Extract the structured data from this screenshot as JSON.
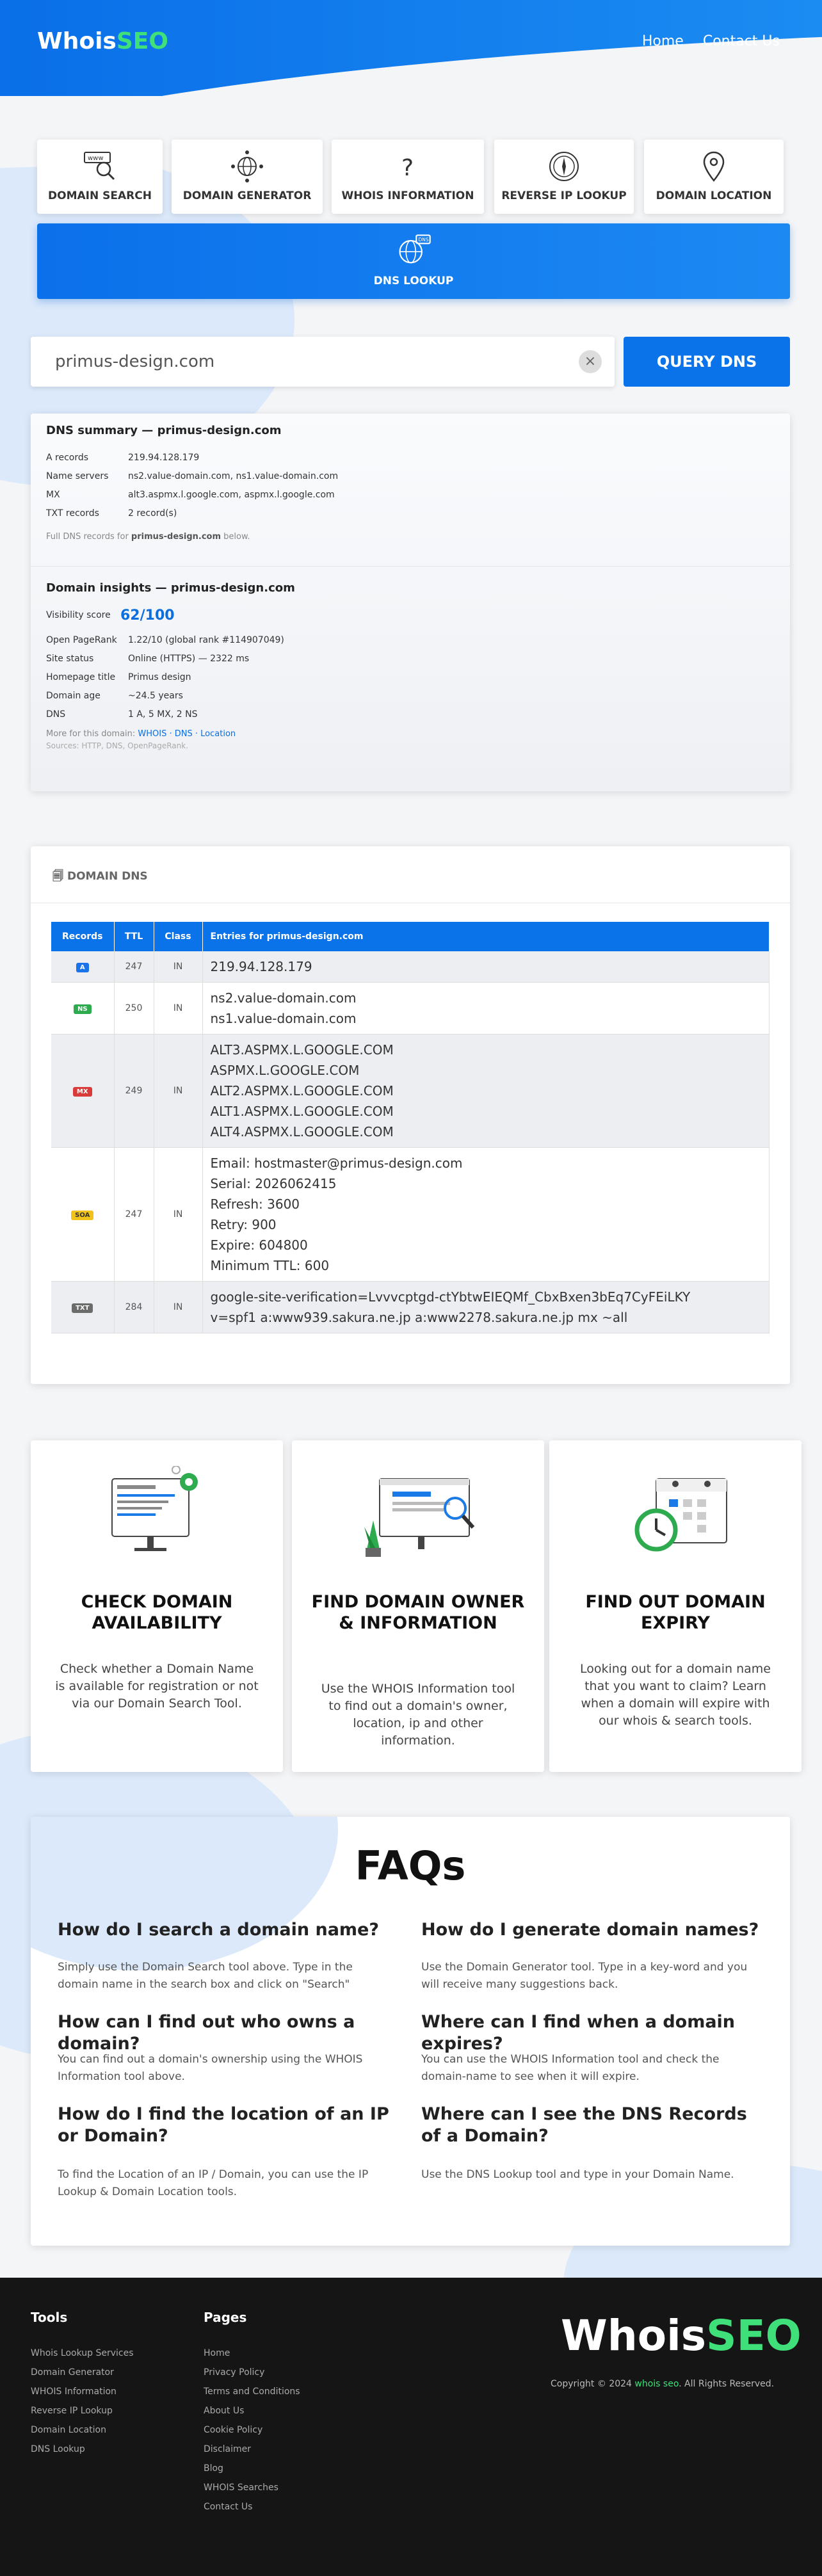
{
  "header": {
    "logo_main": "Whois",
    "logo_accent": "SEO",
    "nav": [
      "Home",
      "Contact Us"
    ]
  },
  "tools": [
    {
      "label": "DOMAIN SEARCH",
      "icon": "www-search-icon"
    },
    {
      "label": "DOMAIN GENERATOR",
      "icon": "network-globe-icon"
    },
    {
      "label": "WHOIS INFORMATION",
      "icon": "question-mark-icon"
    },
    {
      "label": "REVERSE IP LOOKUP",
      "icon": "compass-icon"
    },
    {
      "label": "DOMAIN LOCATION",
      "icon": "map-pin-icon"
    }
  ],
  "dns_lookup": {
    "label": "DNS LOOKUP",
    "icon": "dns-globe-icon"
  },
  "search": {
    "value": "primus-design.com",
    "clear": "×",
    "button": "QUERY DNS"
  },
  "summary": {
    "title": "DNS summary — primus-design.com",
    "rows": [
      {
        "k": "A records",
        "v": "219.94.128.179"
      },
      {
        "k": "Name servers",
        "v": "ns2.value-domain.com, ns1.value-domain.com"
      },
      {
        "k": "MX",
        "v": "alt3.aspmx.l.google.com, aspmx.l.google.com"
      },
      {
        "k": "TXT records",
        "v": "2 record(s)"
      }
    ],
    "note_prefix": "Full DNS records for ",
    "note_domain": "primus-design.com",
    "note_suffix": " below."
  },
  "insights": {
    "title": "Domain insights — primus-design.com",
    "vis_label": "Visibility score",
    "vis_value": "62/100",
    "rows": [
      {
        "k": "Open PageRank",
        "v": "1.22/10 (global rank #114907049)"
      },
      {
        "k": "Site status",
        "v": "Online (HTTPS) — 2322 ms"
      },
      {
        "k": "Homepage title",
        "v": "Primus design"
      },
      {
        "k": "Domain age",
        "v": "~24.5 years"
      },
      {
        "k": "DNS",
        "v": "1 A, 5 MX, 2 NS"
      }
    ],
    "more_prefix": "More for this domain: ",
    "more_links": "WHOIS · DNS · Location",
    "sources": "Sources: HTTP, DNS, OpenPageRank."
  },
  "dns_table": {
    "heading": "DOMAIN DNS",
    "columns": [
      "Records",
      "TTL",
      "Class",
      "Entries for primus-design.com"
    ],
    "rows": [
      {
        "type": "A",
        "color": "#1a73e8",
        "ttl": "247",
        "class": "IN",
        "entries": [
          "219.94.128.179"
        ]
      },
      {
        "type": "NS",
        "color": "#2eaa4f",
        "ttl": "250",
        "class": "IN",
        "entries": [
          "ns2.value-domain.com",
          "ns1.value-domain.com"
        ]
      },
      {
        "type": "MX",
        "color": "#d93a3a",
        "ttl": "249",
        "class": "IN",
        "entries": [
          "ALT3.ASPMX.L.GOOGLE.COM",
          "ASPMX.L.GOOGLE.COM",
          "ALT2.ASPMX.L.GOOGLE.COM",
          "ALT1.ASPMX.L.GOOGLE.COM",
          "ALT4.ASPMX.L.GOOGLE.COM"
        ]
      },
      {
        "type": "SOA",
        "color": "#f1c21b",
        "ttl": "247",
        "class": "IN",
        "entries": [
          "Email: hostmaster@primus-design.com",
          "Serial: 2026062415",
          "Refresh: 3600",
          "Retry: 900",
          "Expire: 604800",
          "Minimum TTL: 600"
        ]
      },
      {
        "type": "TXT",
        "color": "#6b6b6b",
        "ttl": "284",
        "class": "IN",
        "entries": [
          "google-site-verification=Lvvvcptgd-ctYbtwEIEQMf_CbxBxen3bEq7CyFEiLKY",
          "v=spf1 a:www939.sakura.ne.jp a:www2278.sakura.ne.jp mx ~all"
        ]
      }
    ]
  },
  "features": [
    {
      "title": "CHECK DOMAIN AVAILABILITY",
      "text": "Check whether a Domain Name is available for registration or not via our Domain Search Tool.",
      "icon": "monitor-gear-icon"
    },
    {
      "title": "FIND DOMAIN OWNER & INFORMATION",
      "text": "Use the WHOIS Information tool to find out a domain's owner, location, ip and other information.",
      "icon": "browser-magnifier-icon"
    },
    {
      "title": "FIND OUT DOMAIN EXPIRY",
      "text": "Looking out for a domain name that you want to claim? Learn when a domain will expire with our whois & search tools.",
      "icon": "calendar-clock-icon"
    }
  ],
  "faq": {
    "title": "FAQs",
    "items": [
      {
        "q": "How do I search a domain name?",
        "a": "Simply use the Domain Search tool above. Type in the domain name in the search box and click on \"Search\""
      },
      {
        "q": "How do I generate domain names?",
        "a": "Use the Domain Generator tool. Type in a key-word and you will receive many suggestions back."
      },
      {
        "q": "How can I find out who owns a domain?",
        "a": "You can find out a domain's ownership using the WHOIS Information tool above."
      },
      {
        "q": "Where can I find when a domain expires?",
        "a": "You can use the WHOIS Information tool and check the domain-name to see when it will expire."
      },
      {
        "q": "How do I find the location of an IP or Domain?",
        "a": "To find the Location of an IP / Domain, you can use the IP Lookup & Domain Location tools."
      },
      {
        "q": "Where can I see the DNS Records of a Domain?",
        "a": "Use the DNS Lookup tool and type in your Domain Name."
      }
    ]
  },
  "footer": {
    "tools_title": "Tools",
    "tools": [
      "Whois Lookup Services",
      "Domain Generator",
      "WHOIS Information",
      "Reverse IP Lookup",
      "Domain Location",
      "DNS Lookup"
    ],
    "pages_title": "Pages",
    "pages": [
      "Home",
      "Privacy Policy",
      "Terms and Conditions",
      "About Us",
      "Cookie Policy",
      "Disclaimer",
      "Blog",
      "WHOIS Searches",
      "Contact Us"
    ],
    "logo_main": "Whois",
    "logo_accent": "SEO",
    "copy_prefix": "Copyright © 2024 ",
    "copy_link": "whois seo",
    "copy_suffix": ". All Rights Reserved."
  }
}
